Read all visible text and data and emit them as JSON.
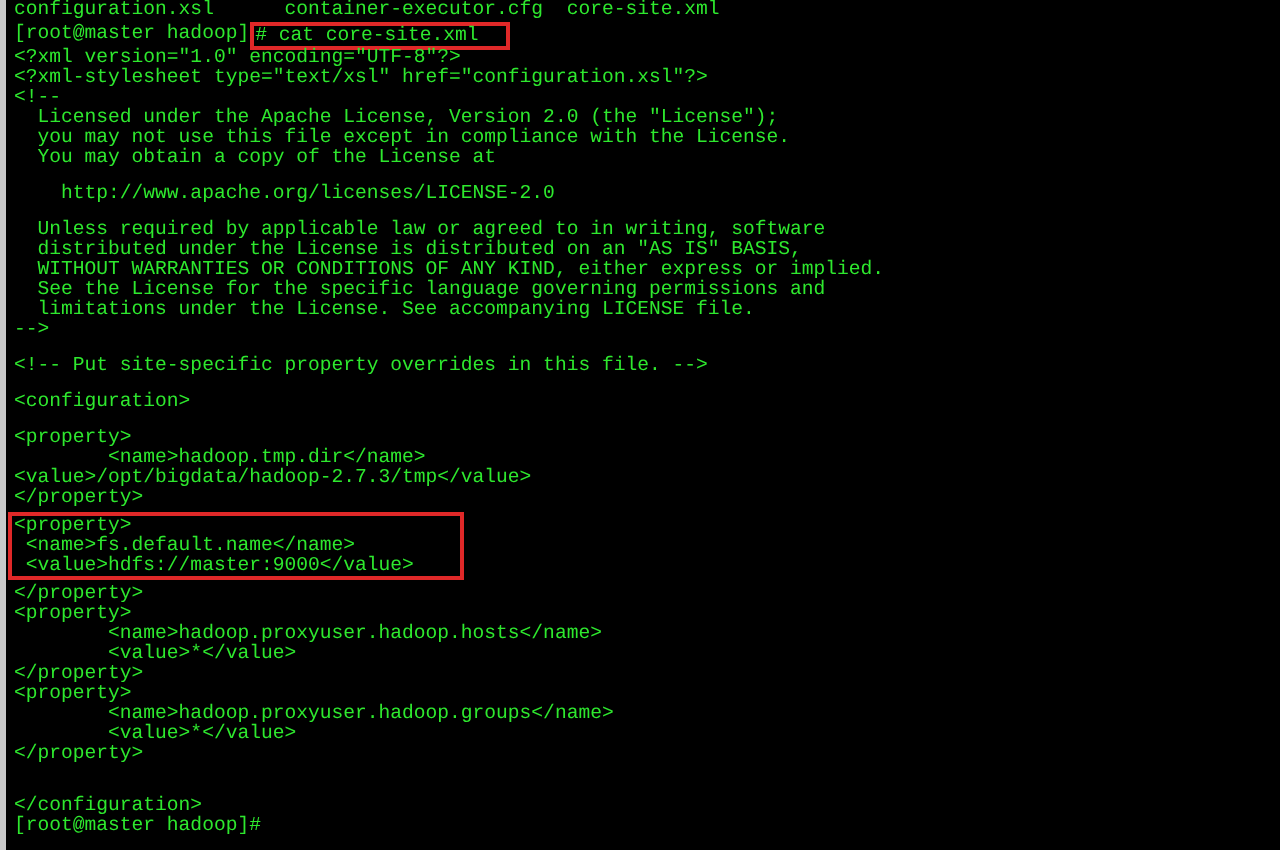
{
  "terminal": {
    "lines": [
      {
        "kind": "text",
        "text": "configuration.xsl      container-executor.cfg  core-site.xml"
      },
      {
        "kind": "command",
        "prompt": "[root@master hadoop]",
        "command": "# cat core-site.xml",
        "highlighted": true
      },
      {
        "kind": "text",
        "text": "<?xml version=\"1.0\" encoding=\"UTF-8\"?>"
      },
      {
        "kind": "text",
        "text": "<?xml-stylesheet type=\"text/xsl\" href=\"configuration.xsl\"?>"
      },
      {
        "kind": "text",
        "text": "<!--"
      },
      {
        "kind": "text",
        "text": "  Licensed under the Apache License, Version 2.0 (the \"License\");"
      },
      {
        "kind": "text",
        "text": "  you may not use this file except in compliance with the License."
      },
      {
        "kind": "text",
        "text": "  You may obtain a copy of the License at"
      },
      {
        "kind": "blank"
      },
      {
        "kind": "text",
        "text": "    http://www.apache.org/licenses/LICENSE-2.0"
      },
      {
        "kind": "blank"
      },
      {
        "kind": "text",
        "text": "  Unless required by applicable law or agreed to in writing, software"
      },
      {
        "kind": "text",
        "text": "  distributed under the License is distributed on an \"AS IS\" BASIS,"
      },
      {
        "kind": "text",
        "text": "  WITHOUT WARRANTIES OR CONDITIONS OF ANY KIND, either express or implied."
      },
      {
        "kind": "text",
        "text": "  See the License for the specific language governing permissions and"
      },
      {
        "kind": "text",
        "text": "  limitations under the License. See accompanying LICENSE file."
      },
      {
        "kind": "text",
        "text": "-->"
      },
      {
        "kind": "blank"
      },
      {
        "kind": "text",
        "text": "<!-- Put site-specific property overrides in this file. -->"
      },
      {
        "kind": "blank"
      },
      {
        "kind": "text",
        "text": "<configuration>"
      },
      {
        "kind": "blank"
      },
      {
        "kind": "text",
        "text": "<property>"
      },
      {
        "kind": "text",
        "text": "        <name>hadoop.tmp.dir</name>"
      },
      {
        "kind": "text",
        "text": "<value>/opt/bigdata/hadoop-2.7.3/tmp</value>"
      },
      {
        "kind": "text",
        "text": "</property>"
      },
      {
        "kind": "block",
        "highlighted": true,
        "lines": [
          "<property>",
          " <name>fs.default.name</name>",
          " <value>hdfs://master:9000</value>"
        ]
      },
      {
        "kind": "text",
        "text": "</property>"
      },
      {
        "kind": "text",
        "text": "<property>"
      },
      {
        "kind": "text",
        "text": "        <name>hadoop.proxyuser.hadoop.hosts</name>"
      },
      {
        "kind": "text",
        "text": "        <value>*</value>"
      },
      {
        "kind": "text",
        "text": "</property>"
      },
      {
        "kind": "text",
        "text": "<property>"
      },
      {
        "kind": "text",
        "text": "        <name>hadoop.proxyuser.hadoop.groups</name>"
      },
      {
        "kind": "text",
        "text": "        <value>*</value>"
      },
      {
        "kind": "text",
        "text": "</property>"
      },
      {
        "kind": "blank"
      },
      {
        "kind": "blank"
      },
      {
        "kind": "text",
        "text": "</configuration>"
      },
      {
        "kind": "text",
        "text": "[root@master hadoop]#"
      }
    ]
  }
}
